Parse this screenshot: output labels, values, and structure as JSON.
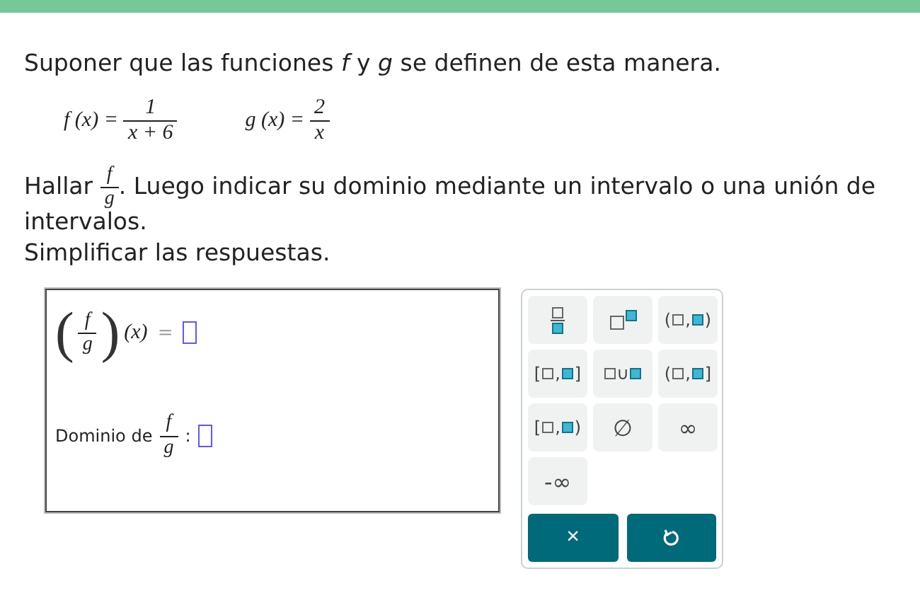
{
  "intro": "Suponer que las funciones *f* y *g* se definen de esta manera.",
  "definitions": [
    {
      "lhs": "f (x) =",
      "numerator": "1",
      "denominator": "x + 6"
    },
    {
      "lhs": "g (x) =",
      "numerator": "2",
      "denominator": "x"
    }
  ],
  "task": {
    "before": "Hallar",
    "numerator": "f",
    "denominator": "g",
    "after": ". Luego indicar su dominio mediante un intervalo o una unión de",
    "continuation": "intervalos."
  },
  "note": "Simplificar las respuestas.",
  "answer": {
    "quotient": {
      "open": "(",
      "close": ")",
      "numerator": "f",
      "denominator": "g",
      "argument": "(x)",
      "equals": "="
    },
    "domain": {
      "label": "Dominio de",
      "numerator": "f",
      "denominator": "g",
      "colon": ":"
    }
  },
  "keypad": {
    "keys": [
      {
        "kind": "fraction"
      },
      {
        "kind": "power"
      },
      {
        "kind": "interval",
        "left": "(",
        "comma": ",",
        "right": ")"
      },
      {
        "kind": "interval",
        "left": "[",
        "comma": ",",
        "right": "]"
      },
      {
        "kind": "union",
        "symbol": "∪"
      },
      {
        "kind": "interval",
        "left": "(",
        "comma": ",",
        "right": "]"
      },
      {
        "kind": "interval",
        "left": "[",
        "comma": ",",
        "right": ")"
      },
      {
        "kind": "symbol",
        "label": "∅"
      },
      {
        "kind": "symbol",
        "label": "∞"
      },
      {
        "kind": "symbol",
        "label": "-∞"
      }
    ],
    "clear": "×"
  }
}
